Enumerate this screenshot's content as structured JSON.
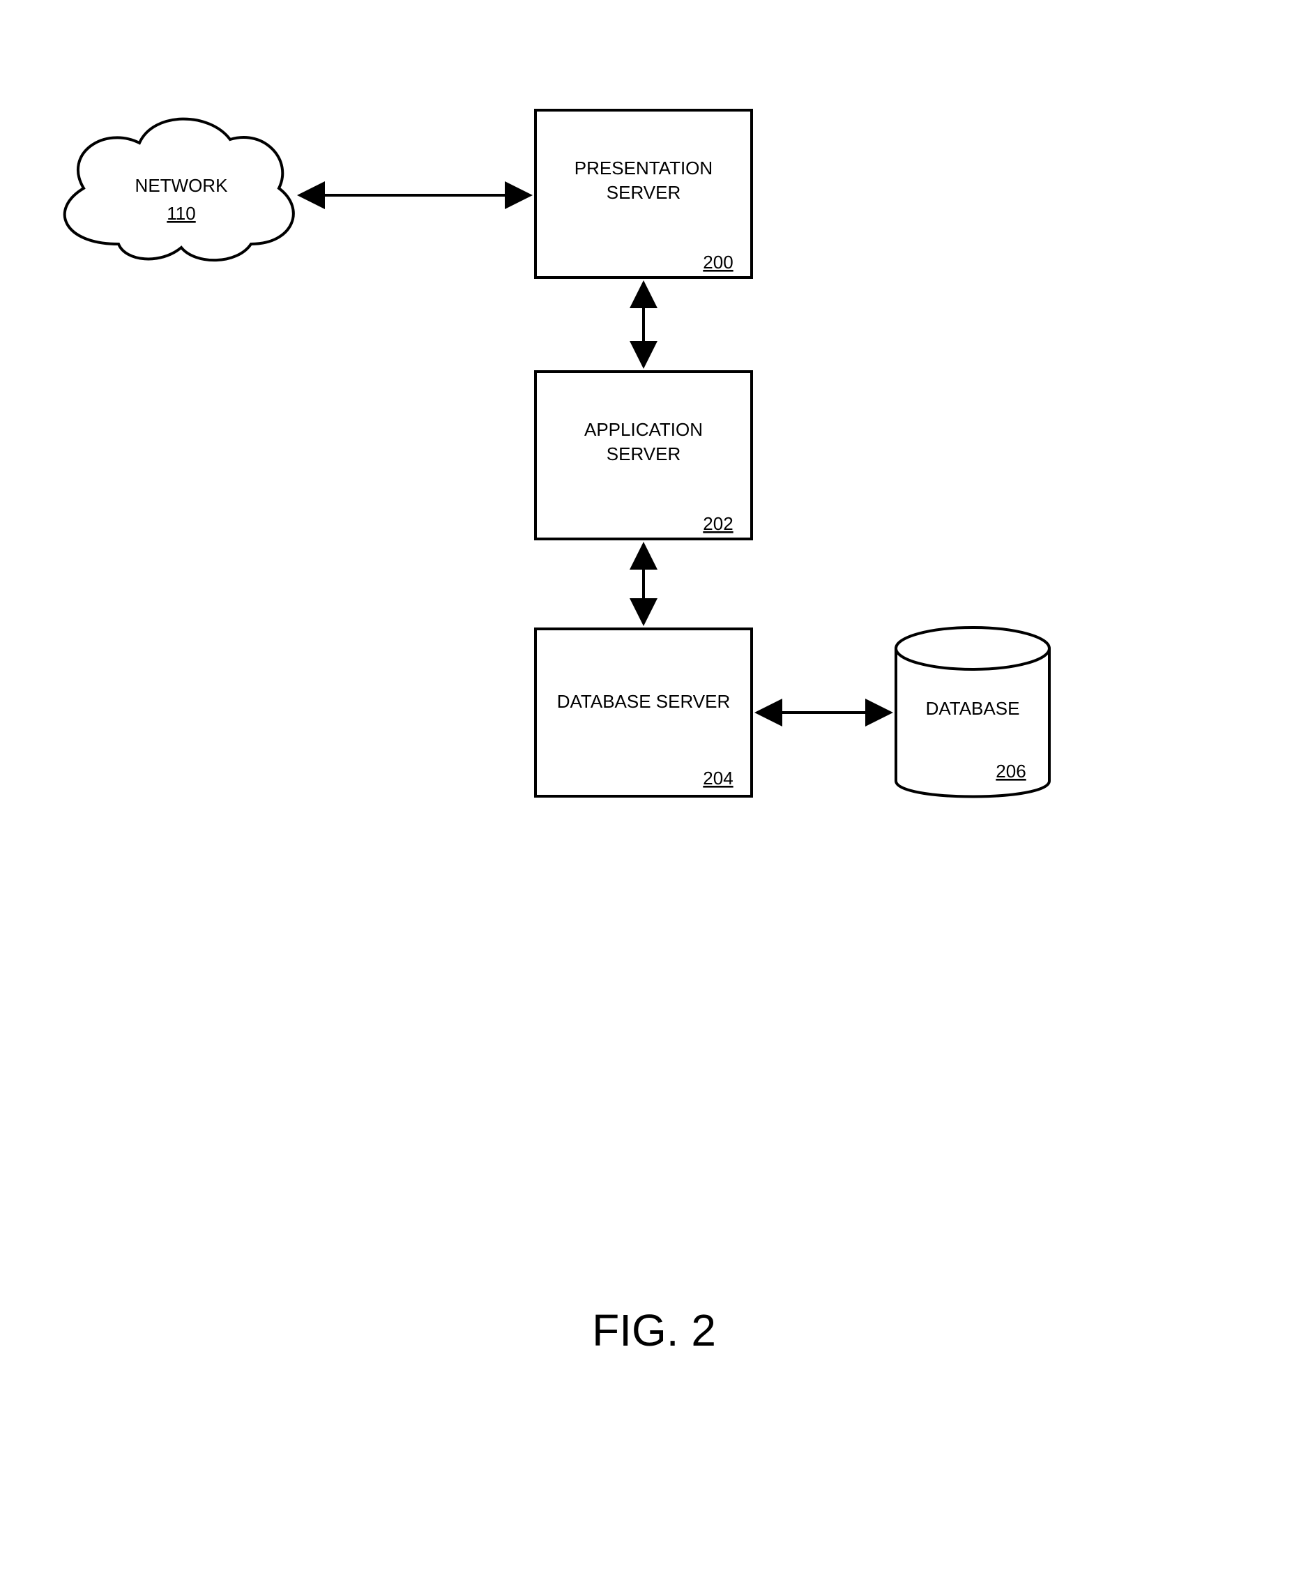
{
  "figure": {
    "caption": "FIG. 2"
  },
  "nodes": {
    "network": {
      "label": "NETWORK",
      "ref": "110"
    },
    "presentation": {
      "label1": "PRESENTATION",
      "label2": "SERVER",
      "ref": "200"
    },
    "application": {
      "label1": "APPLICATION",
      "label2": "SERVER",
      "ref": "202"
    },
    "dbserver": {
      "label": "DATABASE SERVER",
      "ref": "204"
    },
    "database": {
      "label": "DATABASE",
      "ref": "206"
    }
  }
}
